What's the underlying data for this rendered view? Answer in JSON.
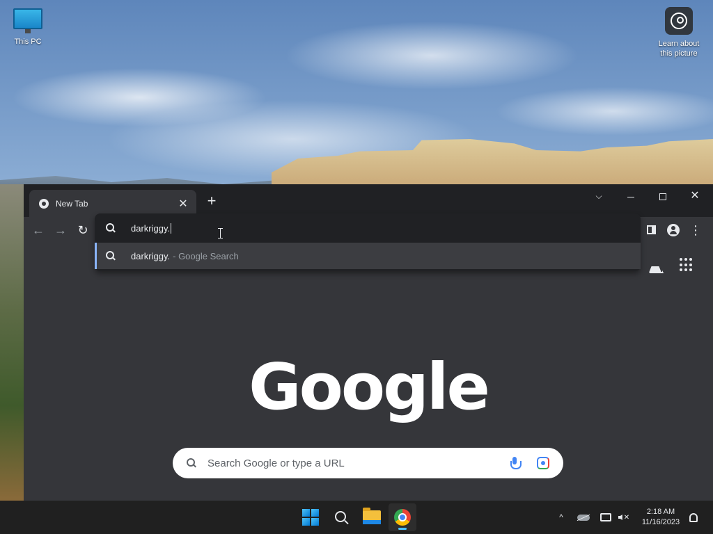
{
  "desktop": {
    "icons": [
      {
        "label": "This PC"
      },
      {
        "label": "Learn about this picture"
      }
    ]
  },
  "browser": {
    "tab": {
      "title": "New Tab",
      "close_glyph": "✕"
    },
    "new_tab_glyph": "+",
    "window_controls": {
      "tab_search": "⌵",
      "close": "✕"
    },
    "nav": {
      "back": "←",
      "forward": "→",
      "reload": "↻",
      "menu": "⋮"
    },
    "omnibox": {
      "text": "darkriggy.",
      "suggestion_query": "darkriggy.",
      "suggestion_suffix": "- Google Search"
    },
    "ntp": {
      "logo": "Google",
      "search_placeholder": "Search Google or type a URL"
    }
  },
  "taskbar": {
    "tray_chevron": "^",
    "time": "2:18 AM",
    "date": "11/16/2023"
  },
  "colors": {
    "window_bg": "#35363a",
    "tabstrip_bg": "#202124",
    "accent_blue": "#8ab4f8",
    "taskbar_bg": "#202020"
  }
}
